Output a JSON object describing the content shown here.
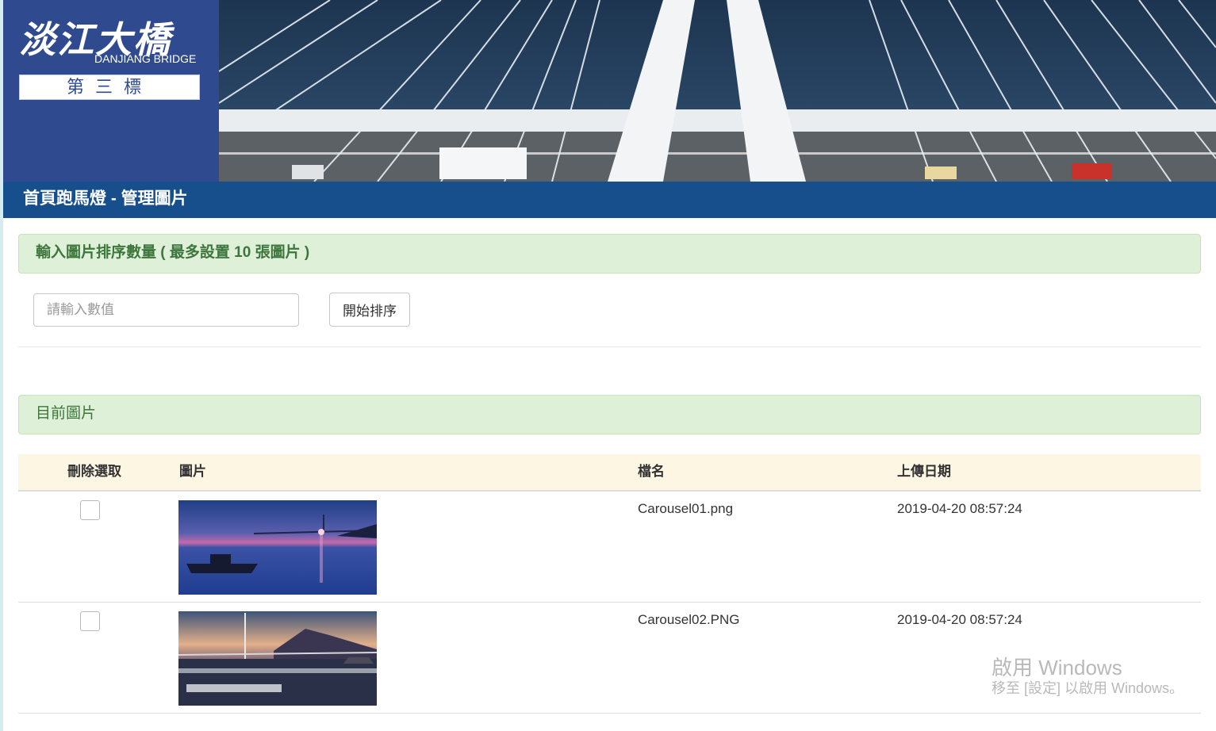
{
  "header": {
    "logo_title": "淡江大橋",
    "logo_subtitle": "DANJIANG BRIDGE",
    "logo_badge": "第三標"
  },
  "page_title": "首頁跑馬燈 - 管理圖片",
  "sort_panel": {
    "heading": "輸入圖片排序數量 ( 最多設置 10 張圖片 )",
    "input_placeholder": "請輸入數值",
    "input_value": "",
    "button_label": "開始排序"
  },
  "current_panel": {
    "heading": "目前圖片"
  },
  "table": {
    "headers": {
      "delete": "刪除選取",
      "image": "圖片",
      "filename": "檔名",
      "upload_date": "上傳日期"
    },
    "rows": [
      {
        "checked": false,
        "image": "sunset-bridge-boat",
        "filename": "Carousel01.png",
        "upload_date": "2019-04-20 08:57:24"
      },
      {
        "checked": false,
        "image": "dusk-harbor-bridge",
        "filename": "Carousel02.PNG",
        "upload_date": "2019-04-20 08:57:24"
      }
    ]
  },
  "watermark": {
    "title": "啟用 Windows",
    "subtitle": "移至 [設定] 以啟用 Windows。"
  },
  "colors": {
    "logo_bg": "#2f4a8e",
    "titlebar_bg": "#164f8c",
    "panel_bg": "#dff0d8",
    "panel_text": "#3c763d",
    "table_head_bg": "#fcf6e3"
  }
}
